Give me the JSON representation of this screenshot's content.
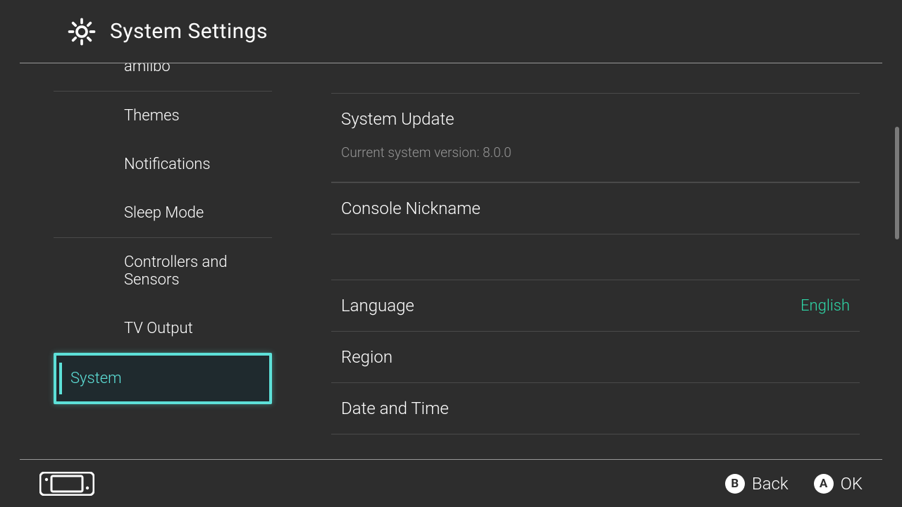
{
  "header": {
    "title": "System Settings"
  },
  "sidebar": {
    "items": [
      {
        "label": "amiibo",
        "group_end": true
      },
      {
        "label": "Themes"
      },
      {
        "label": "Notifications"
      },
      {
        "label": "Sleep Mode",
        "group_end": true
      },
      {
        "label": "Controllers and Sensors"
      },
      {
        "label": "TV Output"
      },
      {
        "label": "System",
        "selected": true
      }
    ]
  },
  "content": {
    "system_update": {
      "label": "System Update",
      "subtext": "Current system version: 8.0.0"
    },
    "console_nickname": {
      "label": "Console Nickname"
    },
    "language": {
      "label": "Language",
      "value": "English"
    },
    "region": {
      "label": "Region"
    },
    "date_time": {
      "label": "Date and Time"
    }
  },
  "footer": {
    "back": {
      "btn": "B",
      "label": "Back"
    },
    "ok": {
      "btn": "A",
      "label": "OK"
    }
  }
}
